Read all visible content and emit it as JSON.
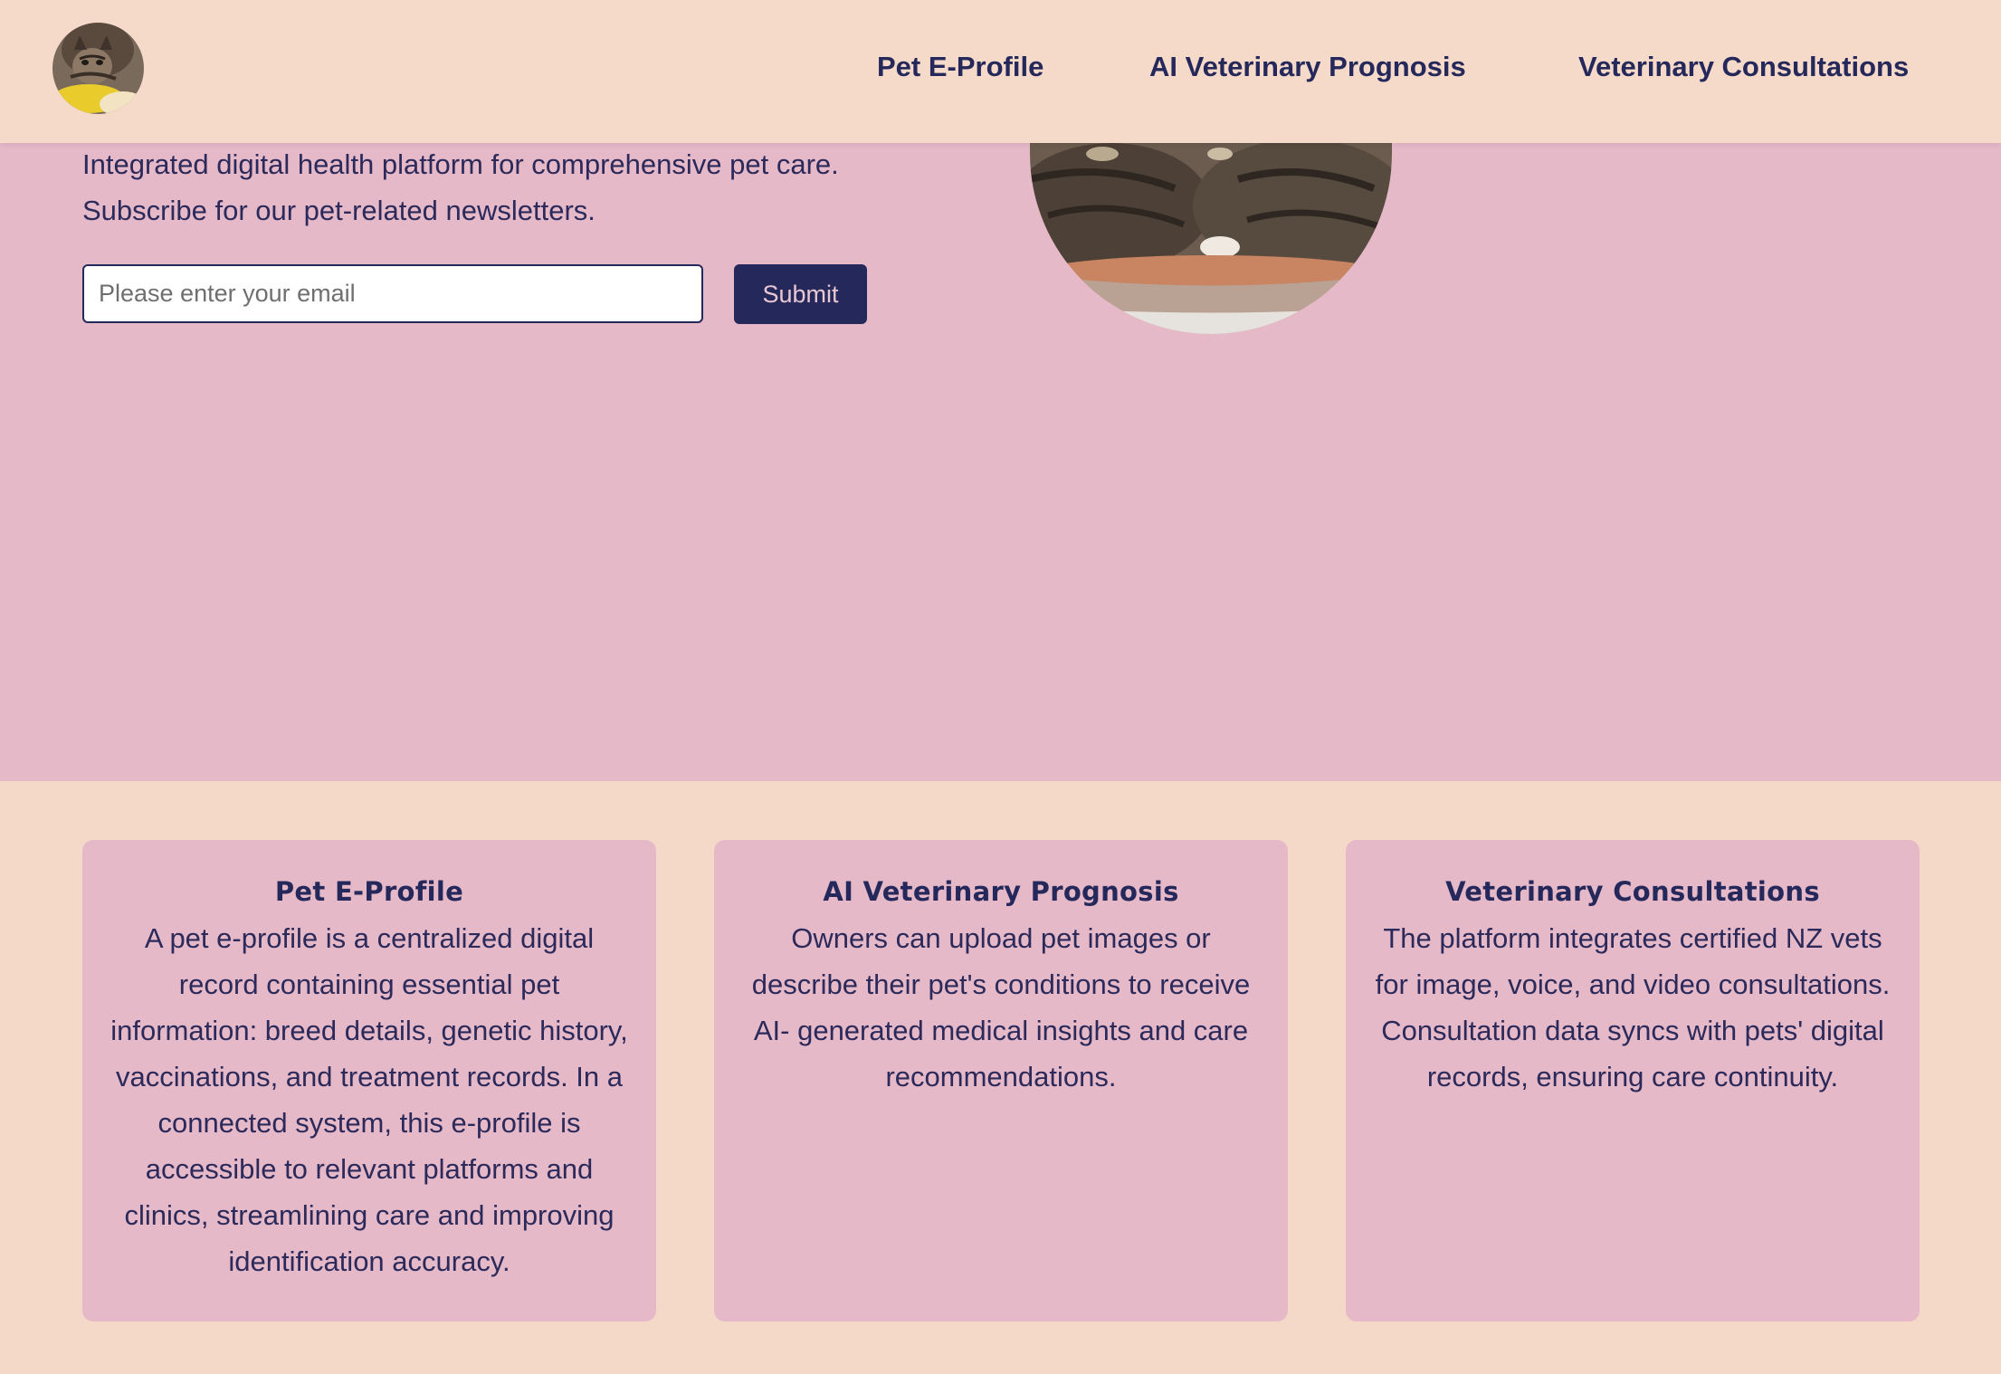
{
  "nav": {
    "logo_alt": "tabby cat avatar",
    "links": [
      "Pet E-Profile",
      "AI Veterinary Prognosis",
      "Veterinary Consultations"
    ]
  },
  "hero": {
    "line1": "Integrated digital health platform for comprehensive pet care.",
    "line2": "Subscribe for our pet-related newsletters.",
    "email_placeholder": "Please enter your email",
    "submit_label": "Submit"
  },
  "features": [
    {
      "title": "Pet E-Profile",
      "body": "A pet e-profile is a centralized digital record containing essential pet information: breed details, genetic history, vaccinations, and treatment records. In a connected system, this e-profile is accessible to relevant platforms and clinics, streamlining care and improving identification accuracy."
    },
    {
      "title": "AI Veterinary Prognosis",
      "body": "Owners can upload pet images or describe their pet's conditions to receive AI- generated medical insights and care recommendations."
    },
    {
      "title": "Veterinary Consultations",
      "body": "The platform integrates certified NZ vets for image, voice, and video consultations. Consultation data syncs with pets' digital records, ensuring care continuity."
    }
  ],
  "colors": {
    "header_bg": "#f5d9c9",
    "hero_bg": "#e6b9c9",
    "accent_navy": "#25285a",
    "card_bg": "#e6b9c9"
  }
}
